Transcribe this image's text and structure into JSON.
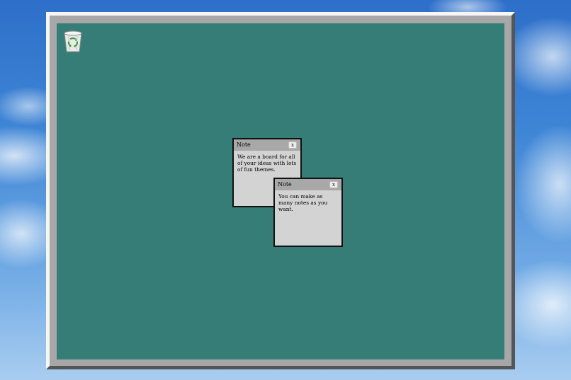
{
  "desktop": {
    "trash_icon": "recycle-bin-icon"
  },
  "notes": [
    {
      "title": "Note",
      "close_label": "x",
      "body": "We are a board for all of your ideas with lots of fun themes."
    },
    {
      "title": "Note",
      "close_label": "x",
      "body": "You can make as many notes as you want."
    }
  ],
  "colors": {
    "desktop": "#367d77",
    "frame": "#a7a7a7",
    "note_bg": "#d3d3d3",
    "note_bar": "#a8a8a8"
  }
}
